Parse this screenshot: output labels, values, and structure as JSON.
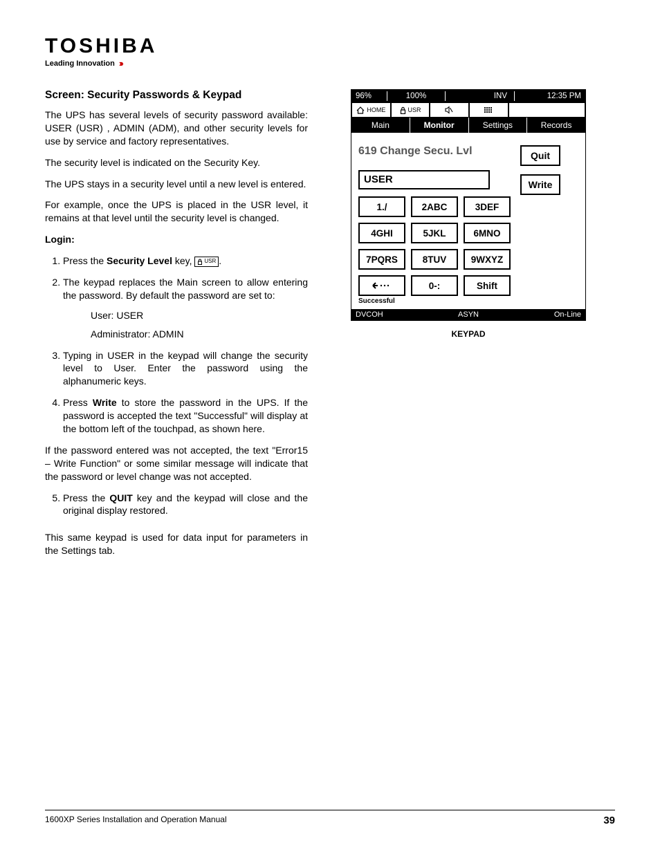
{
  "brand": {
    "name": "TOSHIBA",
    "tagline": "Leading Innovation"
  },
  "section_title": "Screen: Security Passwords & Keypad",
  "paragraphs": {
    "p1": "The UPS has several levels of security password available: USER (USR) , ADMIN (ADM), and other security levels for use by service and factory representatives.",
    "p2": "The security level is indicated on the Security Key.",
    "p3": "The UPS stays in a security level until a new level is entered.",
    "p4": "For example, once the UPS is placed in the USR level, it remains at that level until the security level is changed.",
    "error": "If the password entered was not accepted, the text \"Error15 – Write Function\" or some similar message will indicate that the password or level change was not accepted.",
    "closing": "This same keypad is used for data input for parameters in the Settings tab."
  },
  "login": {
    "header": "Login:",
    "step1_pre": "Press the ",
    "step1_bold": "Security Level",
    "step1_post": " key, ",
    "key_icon_label": "USR",
    "step2": "The keypad replaces the Main screen to allow entering the password. By default  the password are set to:",
    "user_default": "User: USER",
    "admin_default": "Administrator: ADMIN",
    "step3": "Typing in USER in the keypad will change the security level to User.  Enter the password using the alphanumeric keys.",
    "step4_pre": "Press ",
    "step4_bold": "Write",
    "step4_post": " to store the password in the UPS.  If the password is accepted the text \"Successful\" will display at the bottom left of the touchpad, as shown here.",
    "step5_pre": "Press the ",
    "step5_bold": "QUIT",
    "step5_post": " key and the keypad will close and the original display restored."
  },
  "panel": {
    "status": {
      "pct1": "96%",
      "pct2": "100%",
      "inv": "INV",
      "time": "12:35 PM"
    },
    "icons": {
      "home": "HOME",
      "usr": "USR"
    },
    "tabs": {
      "main": "Main",
      "monitor": "Monitor",
      "settings": "Settings",
      "records": "Records"
    },
    "title": "619 Change Secu. Lvl",
    "input": "USER",
    "keys": {
      "k1": "1./",
      "k2": "2ABC",
      "k3": "3DEF",
      "k4": "4GHI",
      "k5": "5JKL",
      "k6": "6MNO",
      "k7": "7PQRS",
      "k8": "8TUV",
      "k9": "9WXYZ",
      "kback": "",
      "k0": "0-:",
      "kshift": "Shift"
    },
    "side": {
      "quit": "Quit",
      "write": "Write"
    },
    "success": "Successful",
    "bottom": {
      "left": "DVCOH",
      "mid": "ASYN",
      "right": "On-Line"
    },
    "caption": "KEYPAD"
  },
  "footer": {
    "left": "1600XP Series Installation and Operation Manual",
    "page": "39"
  }
}
